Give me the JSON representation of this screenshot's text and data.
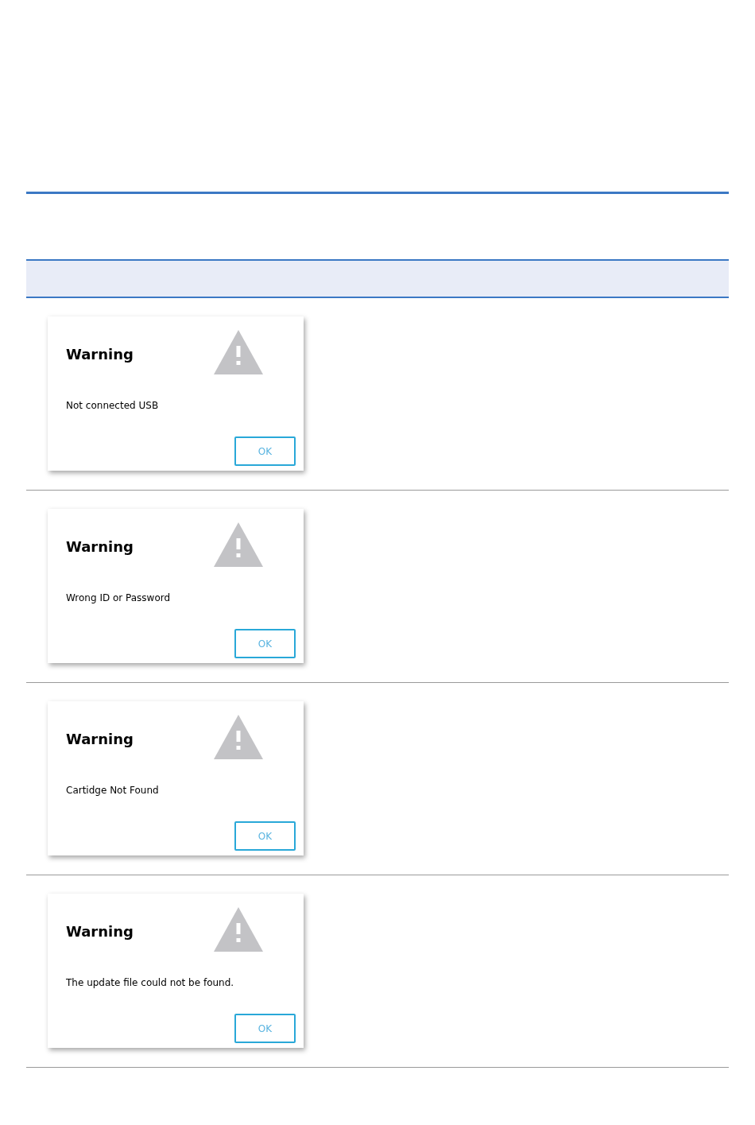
{
  "rows": [
    {
      "dialog": {
        "title": "Warning",
        "message": "Not connected USB",
        "button": "OK"
      }
    },
    {
      "dialog": {
        "title": "Warning",
        "message": "Wrong ID or Password",
        "button": "OK"
      }
    },
    {
      "dialog": {
        "title": "Warning",
        "message": "Cartidge Not Found",
        "button": "OK"
      }
    },
    {
      "dialog": {
        "title": "Warning",
        "message": "The update file could not be found.",
        "button": "OK"
      }
    }
  ]
}
